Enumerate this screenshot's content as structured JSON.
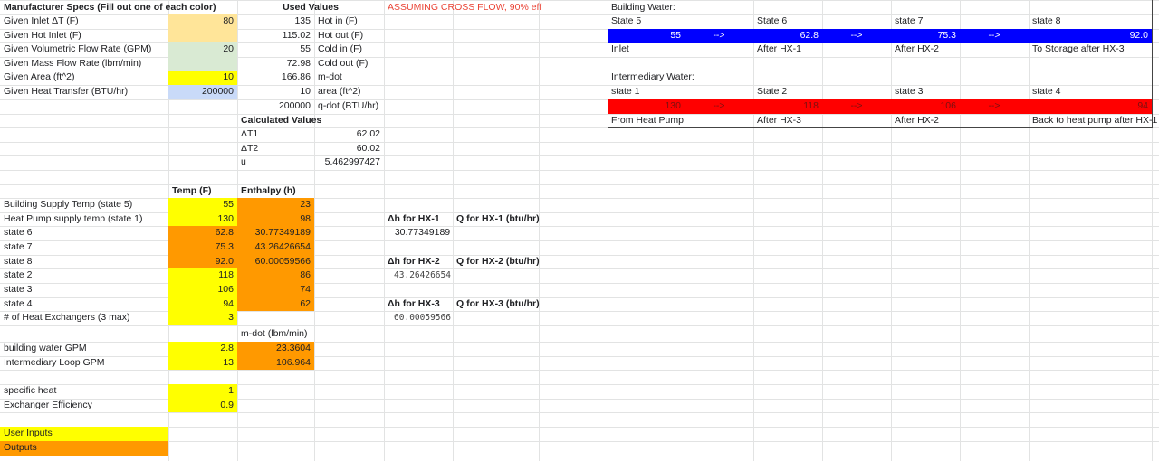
{
  "colors": {
    "peach": "#ffe599",
    "green": "#d9ead3",
    "yellow": "#ffff00",
    "lightblue": "#c9daf8",
    "orange": "#ff9900",
    "blue": "#0000ff",
    "red": "#ff0000"
  },
  "specs": {
    "header": "Manufacturer Specs (Fill out one of each color)",
    "rows": [
      {
        "label": "Given Inlet ΔT (F)",
        "value": "80"
      },
      {
        "label": "Given Hot Inlet (F)",
        "value": ""
      },
      {
        "label": "Given Volumetric Flow Rate (GPM)",
        "value": "20"
      },
      {
        "label": "Given Mass Flow Rate (lbm/min)",
        "value": ""
      },
      {
        "label": "Given Area (ft^2)",
        "value": "10"
      },
      {
        "label": "Given Heat Transfer (BTU/hr)",
        "value": "200000"
      }
    ]
  },
  "used": {
    "header": "Used Values",
    "rows": [
      {
        "value": "135",
        "label": "Hot in (F)"
      },
      {
        "value": "115.02",
        "label": "Hot out (F)"
      },
      {
        "value": "55",
        "label": "Cold in (F)"
      },
      {
        "value": "72.98",
        "label": "Cold out (F)"
      },
      {
        "value": "166.86",
        "label": "m-dot"
      },
      {
        "value": "10",
        "label": "area (ft^2)"
      },
      {
        "value": "200000",
        "label": "q-dot (BTU/hr)"
      }
    ],
    "note": "ASSUMING CROSS FLOW, 90% eff"
  },
  "calculated": {
    "header": "Calculated Values",
    "rows": [
      {
        "label": "ΔT1",
        "value": "62.02"
      },
      {
        "label": "ΔT2",
        "value": "60.02"
      },
      {
        "label": "u",
        "value": "5.462997427"
      }
    ]
  },
  "states": {
    "temp_header": "Temp (F)",
    "enthalpy_header": "Enthalpy (h)",
    "rows": [
      {
        "label": "Building Supply Temp (state 5)",
        "temp": "55",
        "h": "23"
      },
      {
        "label": "Heat Pump supply temp (state 1)",
        "temp": "130",
        "h": "98"
      },
      {
        "label": "state 6",
        "temp": "62.8",
        "h": "30.77349189"
      },
      {
        "label": "state 7",
        "temp": "75.3",
        "h": "43.26426654"
      },
      {
        "label": "state 8",
        "temp": "92.0",
        "h": "60.00059566"
      },
      {
        "label": "state 2",
        "temp": "118",
        "h": "86"
      },
      {
        "label": "state 3",
        "temp": "106",
        "h": "74"
      },
      {
        "label": "state 4",
        "temp": "94",
        "h": "62"
      }
    ],
    "hx_count_label": "# of Heat Exchangers (3 max)",
    "hx_count": "3",
    "mdot_header": "m-dot (lbm/min)",
    "flows": [
      {
        "label": "building water GPM",
        "gpm": "2.8",
        "mdot": "23.3604"
      },
      {
        "label": "Intermediary Loop GPM",
        "gpm": "13",
        "mdot": "106.964"
      }
    ],
    "specific_heat_label": "specific heat",
    "specific_heat": "1",
    "efficiency_label": "Exchanger Efficiency",
    "efficiency": "0.9"
  },
  "hx": [
    {
      "dh_label": "Δh for HX-1",
      "q_label": "Q for HX-1 (btu/hr)",
      "dh": "30.77349189"
    },
    {
      "dh_label": "Δh for HX-2",
      "q_label": "Q for HX-2 (btu/hr)",
      "dh": "43.26426654"
    },
    {
      "dh_label": "Δh for HX-3",
      "q_label": "Q for HX-3 (btu/hr)",
      "dh": "60.00059566"
    }
  ],
  "legend": {
    "inputs": "User Inputs",
    "outputs": "Outputs"
  },
  "building": {
    "title": "Building Water:",
    "states": [
      "State 5",
      "State 6",
      "state 7",
      "state 8"
    ],
    "values": [
      "55",
      "62.8",
      "75.3",
      "92.0"
    ],
    "arrow": "-->",
    "labels": [
      "Inlet",
      "After HX-1",
      "After HX-2",
      "To Storage after HX-3"
    ]
  },
  "intermediary": {
    "title": "Intermediary Water:",
    "states": [
      "state 1",
      "State 2",
      "state 3",
      "state 4"
    ],
    "values": [
      "130",
      "118",
      "106",
      "94"
    ],
    "arrow": "-->",
    "labels": [
      "From Heat Pump",
      "After HX-3",
      "After HX-2",
      "Back to heat pump after HX-1"
    ]
  }
}
